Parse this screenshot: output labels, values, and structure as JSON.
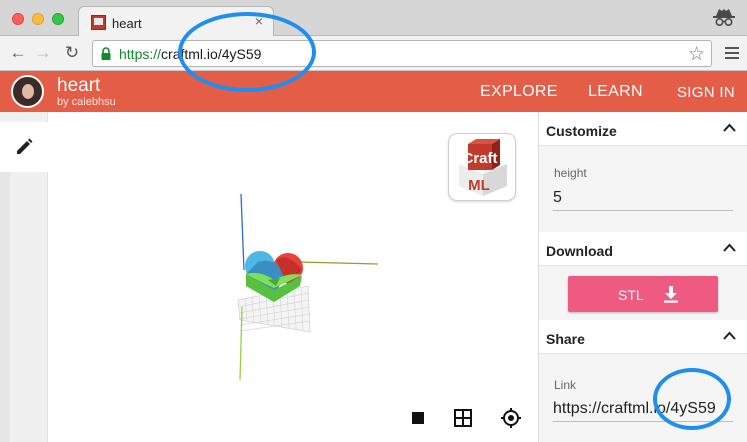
{
  "browser": {
    "tab_title": "heart",
    "tab_close": "×",
    "url_scheme": "https://",
    "url_rest": "craftml.io/4yS59",
    "bookmark_icon": "star-icon"
  },
  "app": {
    "project_title": "heart",
    "project_author": "by calebhsu",
    "nav": {
      "explore": "EXPLORE",
      "learn": "LEARN",
      "signin": "SIGN IN"
    },
    "accent_color": "#e35d47"
  },
  "logo": {
    "top_text": "Craft",
    "bottom_text": "ML"
  },
  "panel": {
    "customize": {
      "title": "Customize",
      "field_label": "height",
      "field_value": "5"
    },
    "download": {
      "title": "Download",
      "button_label": "STL",
      "button_color": "#ef5a82"
    },
    "share": {
      "title": "Share",
      "field_label": "Link",
      "field_value": "https://craftml.io/4yS59"
    }
  },
  "annotation_color": "#1e8ef0"
}
